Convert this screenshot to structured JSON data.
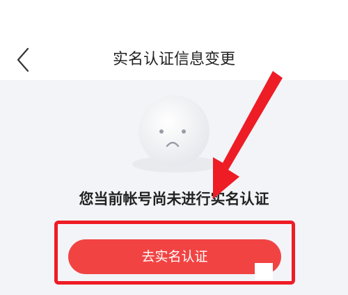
{
  "header": {
    "title": "实名认证信息变更",
    "back_icon": "chevron-left-icon"
  },
  "main": {
    "empty_icon": "sad-face-icon",
    "message": "您当前帐号尚未进行实名认证",
    "action_button_label": "去实名认证"
  },
  "colors": {
    "annotation_red": "#ee1c25",
    "button_red": "#f24343",
    "page_background": "#f3f4f8"
  }
}
